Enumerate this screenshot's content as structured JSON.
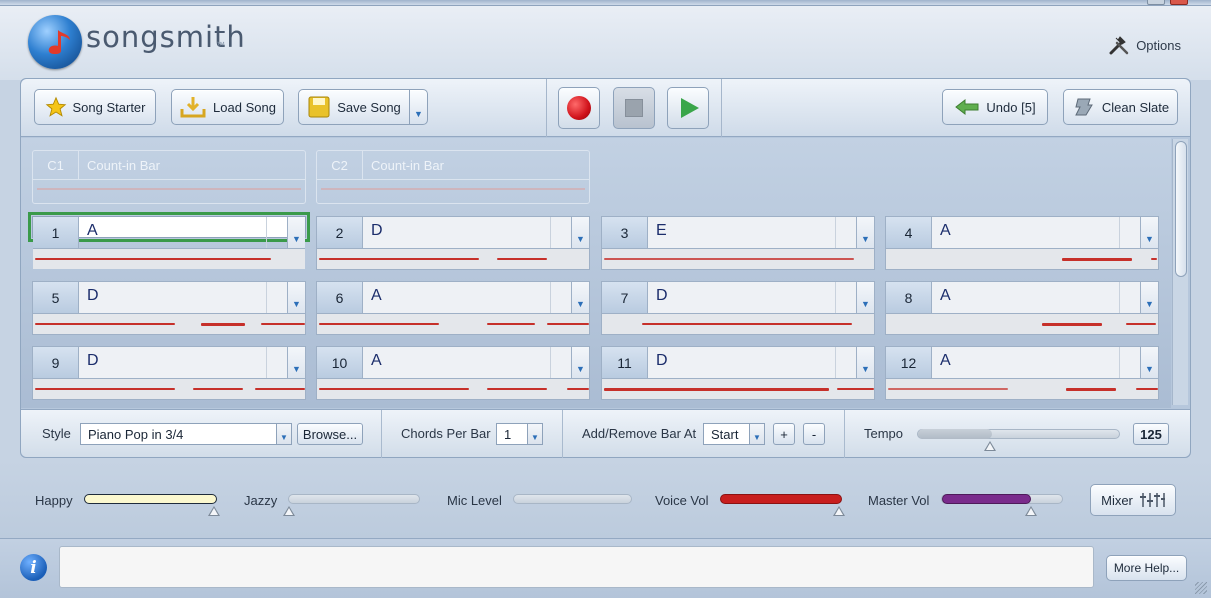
{
  "app": {
    "logo_text": "songsmith",
    "options_label": "Options"
  },
  "toolbar": {
    "song_starter": "Song Starter",
    "load_song": "Load Song",
    "save_song": "Save Song",
    "undo": "Undo [5]",
    "clean_slate": "Clean Slate"
  },
  "count_in": [
    {
      "num": "C1",
      "label": "Count-in Bar"
    },
    {
      "num": "C2",
      "label": "Count-in Bar"
    }
  ],
  "bars": [
    {
      "num": "1",
      "chord": "A"
    },
    {
      "num": "2",
      "chord": "D"
    },
    {
      "num": "3",
      "chord": "E"
    },
    {
      "num": "4",
      "chord": "A"
    },
    {
      "num": "5",
      "chord": "D"
    },
    {
      "num": "6",
      "chord": "A"
    },
    {
      "num": "7",
      "chord": "D"
    },
    {
      "num": "8",
      "chord": "A"
    },
    {
      "num": "9",
      "chord": "D"
    },
    {
      "num": "10",
      "chord": "A"
    },
    {
      "num": "11",
      "chord": "D"
    },
    {
      "num": "12",
      "chord": "A"
    }
  ],
  "selected_bar": "1",
  "options": {
    "style_label": "Style",
    "style_value": "Piano Pop in 3/4",
    "browse": "Browse...",
    "chords_per_bar_label": "Chords Per Bar",
    "chords_per_bar_value": "1",
    "add_remove_label": "Add/Remove Bar At",
    "add_remove_value": "Start",
    "plus": "+",
    "minus": "-",
    "tempo_label": "Tempo",
    "tempo_value": "125"
  },
  "sliders": {
    "happy_label": "Happy",
    "happy_level": 1.0,
    "jazzy_label": "Jazzy",
    "jazzy_level": 0.0,
    "mic_label": "Mic Level",
    "mic_level": 0.0,
    "voice_label": "Voice Vol",
    "voice_level": 1.0,
    "master_label": "Master Vol",
    "master_level": 0.74,
    "tempo_level": 0.37
  },
  "mixer_label": "Mixer",
  "more_help": "More Help...",
  "colors": {
    "record": "#d0121b",
    "play": "#3aa64a",
    "selected_outline": "#3a9a4a",
    "voice_fill": "#c81e1e",
    "master_fill": "#7a2b8c",
    "happy_fill": "#fbf8cf",
    "chord_text": "#1b2d6b"
  }
}
